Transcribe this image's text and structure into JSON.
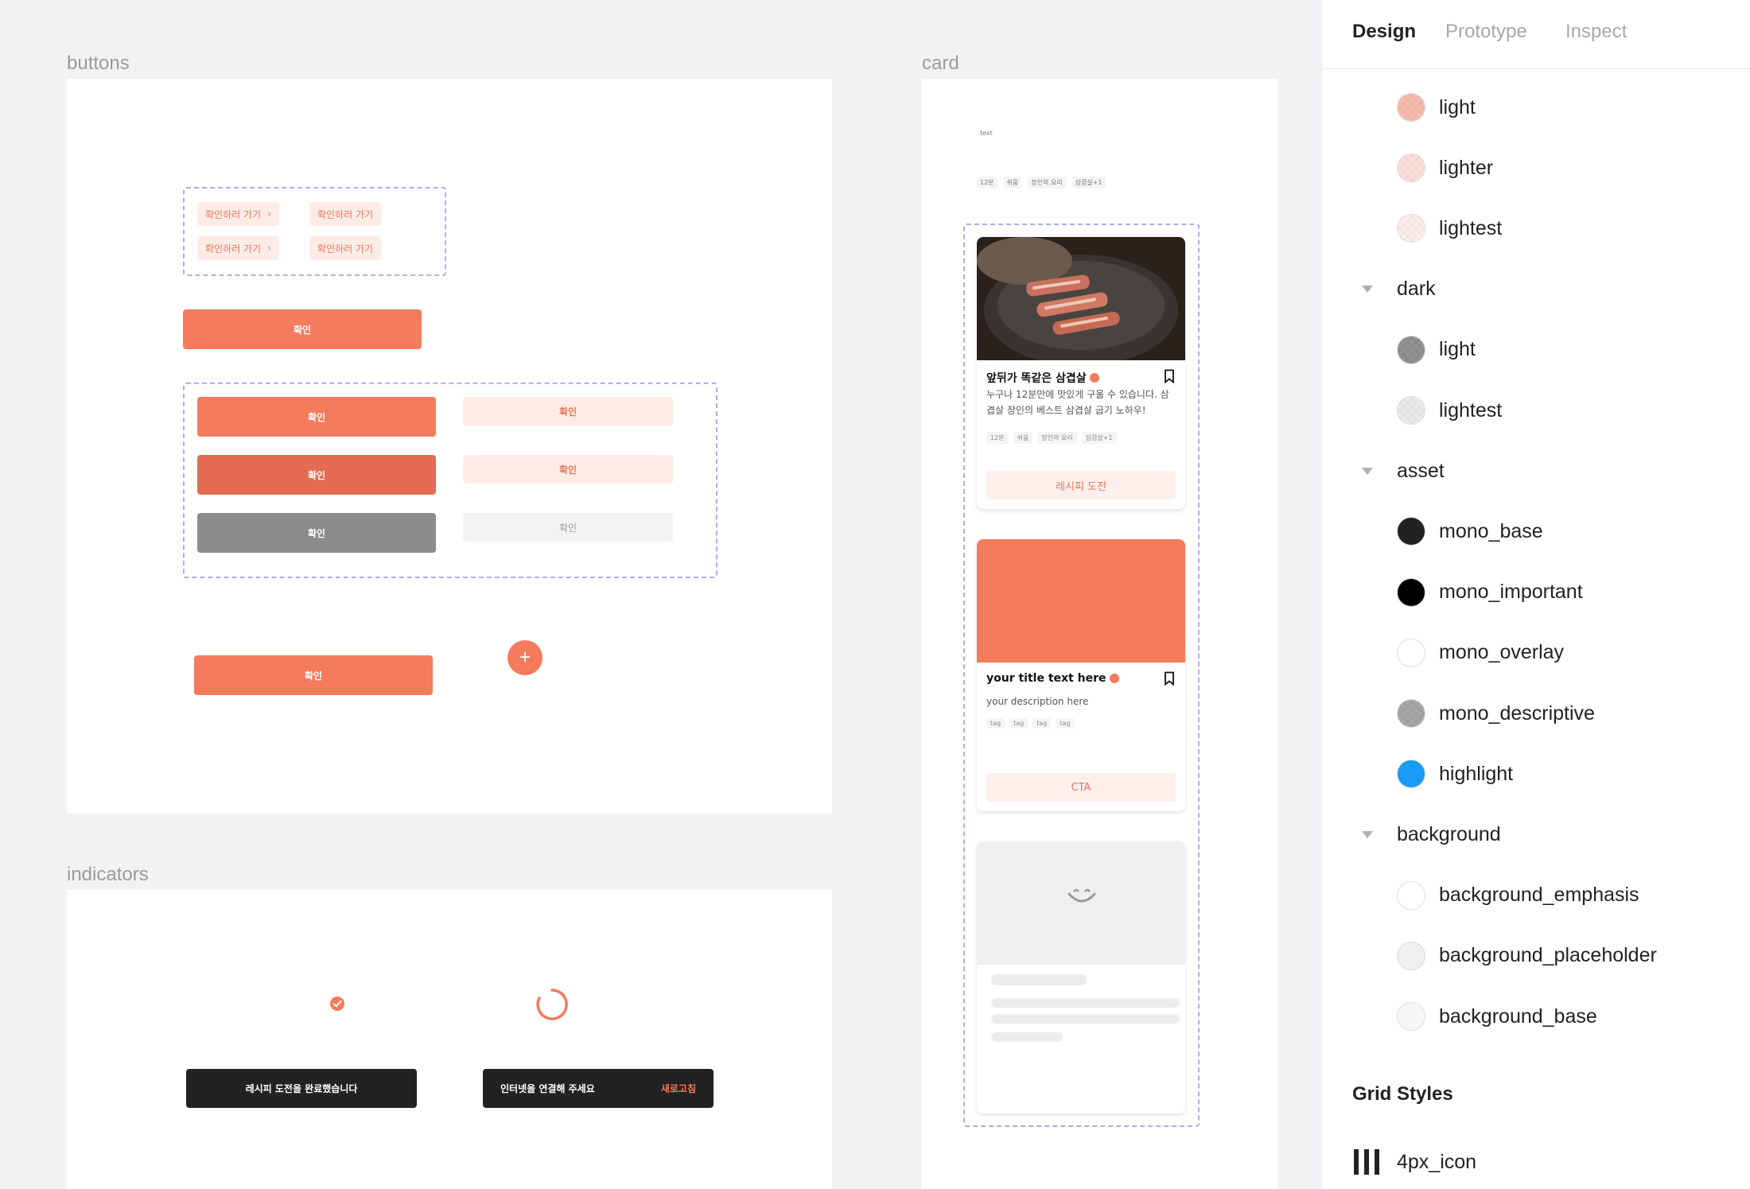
{
  "canvas": {
    "buttons_frame_label": "buttons",
    "card_frame_label": "card",
    "indicators_frame_label": "indicators",
    "buttons": {
      "chip_label": "확인하러 가기",
      "confirm_label": "확인",
      "fab_label": "+"
    },
    "indicators": {
      "toast_success": "레시피 도전을 완료했습니다",
      "toast_offline": "인터넷을 연결해 주세요",
      "toast_action": "새로고침"
    },
    "card_frame": {
      "text_sample": "text",
      "tags": [
        "12분",
        "쉬움",
        "장인의 요리",
        "삼겹살+1"
      ],
      "recipe_card": {
        "title": "앞뒤가 똑같은 삼겹살",
        "description": "누구나 12분만에 맛있게 구울 수 있습니다. 삼겹살 장인의 베스트 삼겹살 굽기 노하우!",
        "tags": [
          "12분",
          "쉬움",
          "장인의 요리",
          "삼겹살+1"
        ],
        "cta": "레시피 도전"
      },
      "template_card": {
        "title": "your title text here",
        "description": "your description here",
        "tags": [
          "tag",
          "tag",
          "tag",
          "tag"
        ],
        "cta": "CTA"
      }
    }
  },
  "panel": {
    "tabs": [
      "Design",
      "Prototype",
      "Inspect"
    ],
    "active_tab": "Design",
    "color_styles": [
      {
        "type": "item",
        "label": "light",
        "swatch": "checker-salmon",
        "color": "#f4a592"
      },
      {
        "type": "item",
        "label": "lighter",
        "swatch": "checker-pink",
        "color": "#f8d5cb"
      },
      {
        "type": "item",
        "label": "lightest",
        "swatch": "checker-faint",
        "color": "#fbe9e4"
      },
      {
        "type": "group",
        "label": "dark"
      },
      {
        "type": "item",
        "label": "light",
        "swatch": "checker-gray",
        "color": "#6e6e6e"
      },
      {
        "type": "item",
        "label": "lightest",
        "swatch": "checker-faint-gray",
        "color": "#e4e4e4"
      },
      {
        "type": "group",
        "label": "asset"
      },
      {
        "type": "item",
        "label": "mono_base",
        "swatch": "solid-dark",
        "color": "#222222"
      },
      {
        "type": "item",
        "label": "mono_important",
        "swatch": "solid",
        "color": "#000000"
      },
      {
        "type": "item",
        "label": "mono_overlay",
        "swatch": "solid",
        "color": "#ffffff"
      },
      {
        "type": "item",
        "label": "mono_descriptive",
        "swatch": "checker-gray",
        "color": "#8a8a8a"
      },
      {
        "type": "item",
        "label": "highlight",
        "swatch": "solid",
        "color": "#1a9bf5"
      },
      {
        "type": "group",
        "label": "background"
      },
      {
        "type": "item",
        "label": "background_emphasis",
        "swatch": "solid",
        "color": "#ffffff"
      },
      {
        "type": "item",
        "label": "background_placeholder",
        "swatch": "solid",
        "color": "#efefef"
      },
      {
        "type": "item",
        "label": "background_base",
        "swatch": "solid",
        "color": "#f7f7f7"
      }
    ],
    "grid_styles_title": "Grid Styles",
    "grid_styles": [
      {
        "label": "4px_icon"
      }
    ]
  }
}
